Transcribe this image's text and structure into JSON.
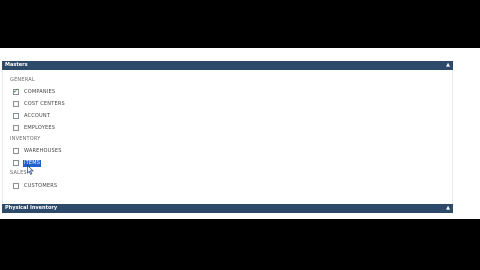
{
  "panels": {
    "masters": {
      "title": "Masters",
      "collapse_icon": "chevron-up-icon",
      "sections": [
        {
          "label": "GENERAL",
          "items": [
            {
              "label": "COMPANIES",
              "checked": true
            },
            {
              "label": "COST CENTERS",
              "checked": false
            },
            {
              "label": "ACCOUNT",
              "checked": false
            },
            {
              "label": "EMPLOYEES",
              "checked": false
            }
          ]
        },
        {
          "label": "INVENTORY",
          "items": [
            {
              "label": "WAREHOUSES",
              "checked": false
            },
            {
              "label": "ITEMS",
              "checked": false,
              "text_selected": true
            }
          ]
        },
        {
          "label": "SALES",
          "items": [
            {
              "label": "CUSTOMERS",
              "checked": false
            }
          ]
        }
      ]
    },
    "physical_inventory": {
      "title": "Physical Inventory",
      "collapse_icon": "chevron-up-icon"
    }
  },
  "colors": {
    "header_bg": "#2e4a6b",
    "selection_bg": "#1f5fcf",
    "check_color": "#3b7a3b"
  }
}
